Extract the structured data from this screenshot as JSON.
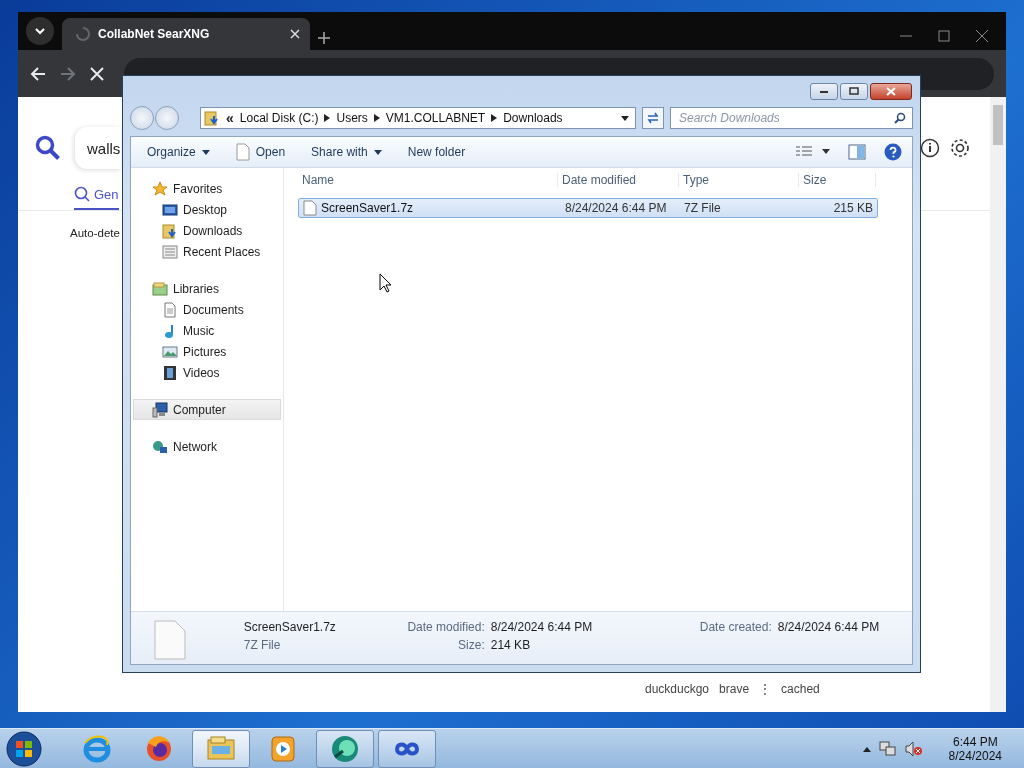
{
  "browser": {
    "tab": {
      "title": "CollabNet SearXNG"
    },
    "search": {
      "value": "walls"
    },
    "category_tab": {
      "label": "Gen",
      "selected": true
    },
    "notice": "Auto-dete",
    "result_engines": [
      "duckduckgo",
      "brave"
    ],
    "result_menu": "⋮",
    "cached_link": "cached"
  },
  "explorer": {
    "breadcrumb_overflow": "«",
    "breadcrumb": [
      "Local Disk (C:)",
      "Users",
      "VM1.COLLABNET",
      "Downloads"
    ],
    "search": {
      "placeholder": "Search Downloads"
    },
    "commands": [
      {
        "label": "Organize",
        "kind": "menu"
      },
      {
        "label": "Open",
        "kind": "open"
      },
      {
        "label": "Share with",
        "kind": "menu"
      },
      {
        "label": "New folder",
        "kind": "plain"
      }
    ],
    "nav": [
      {
        "label": "Favorites",
        "kind": "star",
        "selected": false,
        "children": [
          {
            "label": "Desktop",
            "kind": "desktop",
            "selected": false
          },
          {
            "label": "Downloads",
            "kind": "downloads",
            "selected": false
          },
          {
            "label": "Recent Places",
            "kind": "recent",
            "selected": false
          }
        ]
      },
      {
        "label": "Libraries",
        "kind": "libraries",
        "selected": false,
        "children": [
          {
            "label": "Documents",
            "kind": "documents",
            "selected": false
          },
          {
            "label": "Music",
            "kind": "music",
            "selected": false
          },
          {
            "label": "Pictures",
            "kind": "pictures",
            "selected": false
          },
          {
            "label": "Videos",
            "kind": "videos",
            "selected": false
          }
        ]
      },
      {
        "label": "Computer",
        "kind": "computer",
        "selected": true
      },
      {
        "label": "Network",
        "kind": "network",
        "selected": false
      }
    ],
    "columns": [
      "Name",
      "Date modified",
      "Type",
      "Size"
    ],
    "files": [
      {
        "name": "ScreenSaver1.7z",
        "date_modified": "8/24/2024 6:44 PM",
        "type": "7Z File",
        "size": "215 KB",
        "selected": true
      }
    ],
    "details": {
      "name": "ScreenSaver1.7z",
      "type": "7Z File",
      "fields": [
        {
          "label": "Date modified:",
          "value": "8/24/2024 6:44 PM"
        },
        {
          "label": "Size:",
          "value": "214 KB"
        },
        {
          "label": "Date created:",
          "value": "8/24/2024 6:44 PM"
        }
      ]
    }
  },
  "taskbar": {
    "apps": [
      {
        "kind": "ie",
        "open": false,
        "selected": false
      },
      {
        "kind": "firefox",
        "open": false,
        "selected": false
      },
      {
        "kind": "explorer",
        "open": true,
        "selected": true
      },
      {
        "kind": "media",
        "open": false,
        "selected": false
      },
      {
        "kind": "green",
        "open": true,
        "selected": false
      },
      {
        "kind": "infinity",
        "open": true,
        "selected": false
      }
    ],
    "clock": {
      "time": "6:44 PM",
      "date": "8/24/2024"
    }
  }
}
